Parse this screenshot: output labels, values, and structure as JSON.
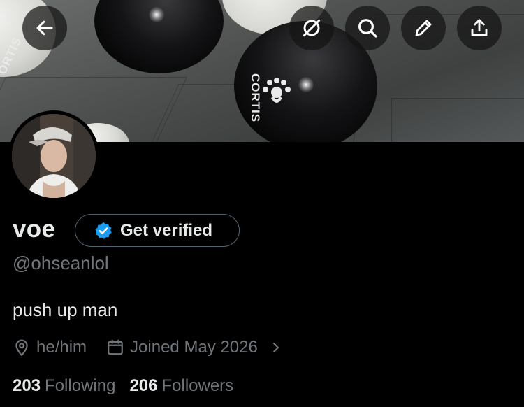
{
  "profile": {
    "display_name": "voe",
    "verify_label": "Get verified",
    "handle": "@ohseanlol",
    "bio": "push up man",
    "pronouns": "he/him",
    "joined": "Joined May 2026",
    "following_count": "203",
    "following_label": "Following",
    "followers_count": "206",
    "followers_label": "Followers"
  },
  "banner": {
    "balloon_text_left": "ORTIS",
    "balloon_text_center": "CORTIS"
  },
  "toolbar": {
    "back_icon": "arrow-left-icon",
    "grok_icon": "grok-icon",
    "search_icon": "search-icon",
    "edit_icon": "pencil-icon",
    "share_icon": "share-upload-icon"
  },
  "colors": {
    "background": "#000000",
    "text_primary": "#e7e9ea",
    "text_secondary": "#71767b",
    "verified_blue": "#1d9bf0",
    "pill_border": "#536471"
  }
}
